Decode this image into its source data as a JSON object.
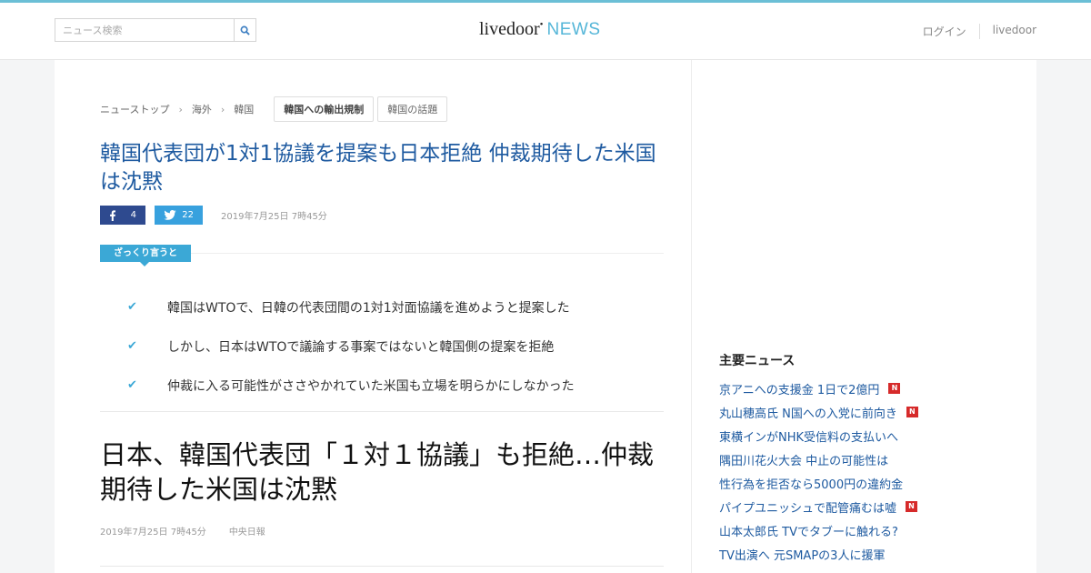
{
  "header": {
    "search_placeholder": "ニュース検索",
    "logo_main": "livedoor",
    "logo_sub": "NEWS",
    "links": [
      "ログイン",
      "livedoor"
    ]
  },
  "breadcrumbs": [
    "ニューストップ",
    "海外",
    "韓国"
  ],
  "tags": [
    "韓国への輸出規制",
    "韓国の話題"
  ],
  "article": {
    "title": "韓国代表団が1対1協議を提案も日本拒絶 仲裁期待した米国は沈黙",
    "facebook_count": "4",
    "twitter_count": "22",
    "date": "2019年7月25日 7時45分",
    "summary_label": "ざっくり言うと",
    "summary_points": [
      "韓国はWTOで、日韓の代表団間の1対1対面協議を進めようと提案した",
      "しかし、日本はWTOで議論する事案ではないと韓国側の提案を拒絶",
      "仲裁に入る可能性がささやかれていた米国も立場を明らかにしなかった"
    ],
    "headline": "日本、韓国代表団「１対１協議」も拒絶…仲裁期待した米国は沈黙",
    "meta_date": "2019年7月25日 7時45分",
    "source": "中央日報"
  },
  "sidebar": {
    "heading": "主要ニュース",
    "news": [
      {
        "text": "京アニへの支援金 1日で2億円",
        "badge": "N"
      },
      {
        "text": "丸山穂高氏 N国への入党に前向き",
        "badge": "N"
      },
      {
        "text": "東横インがNHK受信料の支払いへ",
        "badge": ""
      },
      {
        "text": "隅田川花火大会 中止の可能性は",
        "badge": ""
      },
      {
        "text": "性行為を拒否なら5000円の違約金",
        "badge": ""
      },
      {
        "text": "パイプユニッシュで配管痛むは嘘",
        "badge": "N"
      },
      {
        "text": "山本太郎氏 TVでタブーに触れる?",
        "badge": ""
      },
      {
        "text": "TV出演へ 元SMAPの3人に援軍",
        "badge": ""
      }
    ]
  }
}
